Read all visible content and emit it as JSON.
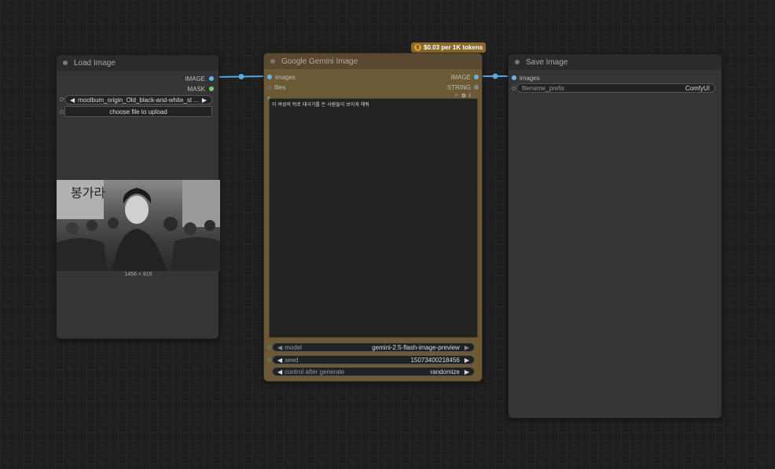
{
  "load_image": {
    "title": "Load Image",
    "outputs": [
      "IMAGE",
      "MASK"
    ],
    "image_widget_value": "moolbum_origin_Old_black-and-white_st ...",
    "upload_button": "choose file to upload",
    "image_size": "1456 × 816"
  },
  "gemini": {
    "title": "Google Gemini Image",
    "price_badge": "$0.03 per 1K tokens",
    "badge_icon": "$",
    "inputs": [
      "images",
      "files"
    ],
    "outputs": [
      "IMAGE",
      "STRING"
    ],
    "prompt_text": "이 여성의 뒤로 태극기를 든 사람들이 보이게 해줘",
    "widgets": [
      {
        "label": "model",
        "value": "gemini-2.5-flash-image-preview"
      },
      {
        "label": "seed",
        "value": "15073400218456"
      },
      {
        "label": "control after generate",
        "value": "randomize"
      }
    ]
  },
  "save_image": {
    "title": "Save Image",
    "inputs": [
      "images"
    ],
    "widget": {
      "label": "filename_prefix",
      "value": "ComfyUI"
    }
  },
  "colors": {
    "gemini_body": "#6b5a35",
    "gemini_title": "#5a4930",
    "badge": "#8a6a2a",
    "wire": "#5aa8e0"
  }
}
